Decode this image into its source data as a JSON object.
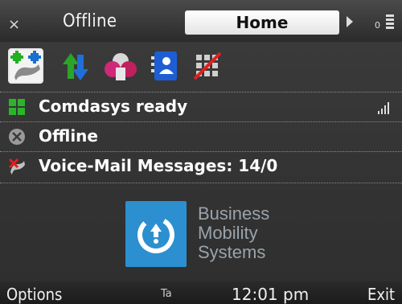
{
  "header": {
    "close_glyph": "×",
    "title": "Offline",
    "active_tab": "Home",
    "battery_label": "0"
  },
  "shortcuts": [
    {
      "name": "phone-add-shortcut",
      "icon": "phone-add-icon"
    },
    {
      "name": "transfer-shortcut",
      "icon": "up-down-arrows-icon"
    },
    {
      "name": "conference-shortcut",
      "icon": "group-icon"
    },
    {
      "name": "contacts-shortcut",
      "icon": "contact-card-icon"
    },
    {
      "name": "dialpad-blocked-shortcut",
      "icon": "dialpad-blocked-icon"
    }
  ],
  "status_rows": {
    "comdasys": "Comdasys ready",
    "presence": "Offline",
    "voicemail": "Voice-Mail Messages: 14/0"
  },
  "logo": {
    "line1": "Business",
    "line2": "Mobility",
    "line3": "Systems"
  },
  "softkeys": {
    "left": "Options",
    "indicator": "Ta",
    "time": "12:01 pm",
    "right": "Exit"
  },
  "colors": {
    "accent": "#2c8fd0",
    "background": "#3a3a3a",
    "tab_bg": "#ffffff"
  }
}
